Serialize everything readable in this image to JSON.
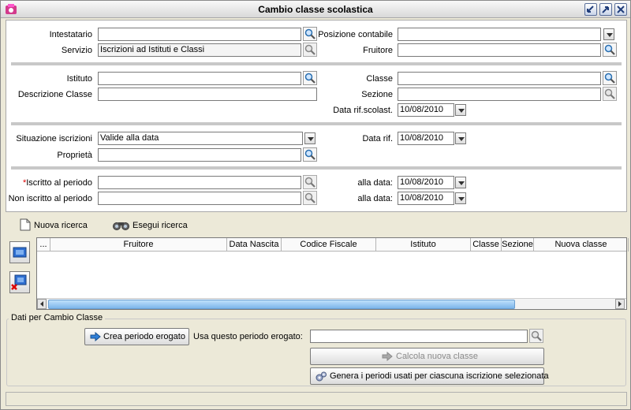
{
  "window": {
    "title": "Cambio classe scolastica"
  },
  "form": {
    "intestatario": {
      "label": "Intestatario",
      "value": ""
    },
    "posizione_contabile": {
      "label": "Posizione contabile",
      "value": ""
    },
    "servizio": {
      "label": "Servizio",
      "value": "Iscrizioni ad Istituti e Classi"
    },
    "fruitore": {
      "label": "Fruitore",
      "value": ""
    },
    "istituto": {
      "label": "Istituto",
      "value": ""
    },
    "classe": {
      "label": "Classe",
      "value": ""
    },
    "descrizione_classe": {
      "label": "Descrizione Classe",
      "value": ""
    },
    "sezione": {
      "label": "Sezione",
      "value": ""
    },
    "data_rif_scolast": {
      "label": "Data rif.scolast.",
      "value": "10/08/2010"
    },
    "situazione_iscrizioni": {
      "label": "Situazione iscrizioni",
      "value": "Valide alla data"
    },
    "data_rif": {
      "label": "Data rif.",
      "value": "10/08/2010"
    },
    "proprieta": {
      "label": "Proprietà",
      "value": ""
    },
    "iscritto_al_periodo": {
      "required_mark": "*",
      "label": "Iscritto al periodo",
      "value": ""
    },
    "alla_data_1": {
      "label": "alla data:",
      "value": "10/08/2010"
    },
    "non_iscritto_al_periodo": {
      "label": "Non iscritto al periodo",
      "value": ""
    },
    "alla_data_2": {
      "label": "alla data:",
      "value": "10/08/2010"
    }
  },
  "toolbar": {
    "nuova_ricerca": "Nuova ricerca",
    "esegui_ricerca": "Esegui ricerca"
  },
  "grid": {
    "columns": [
      "...",
      "Fruitore",
      "Data Nascita",
      "Codice Fiscale",
      "Istituto",
      "Classe",
      "Sezione",
      "Nuova classe"
    ],
    "rows": []
  },
  "cambio_classe": {
    "legend": "Dati per Cambio Classe",
    "crea_periodo_erogato": "Crea periodo erogato",
    "usa_periodo_label": "Usa questo periodo erogato:",
    "usa_periodo_value": "",
    "calcola_nuova_classe": "Calcola nuova classe",
    "genera_periodi": "Genera i periodi usati per ciascuna iscrizione selezionata"
  },
  "colors": {
    "accent": "#7cb6eb",
    "required": "#dd0000"
  }
}
